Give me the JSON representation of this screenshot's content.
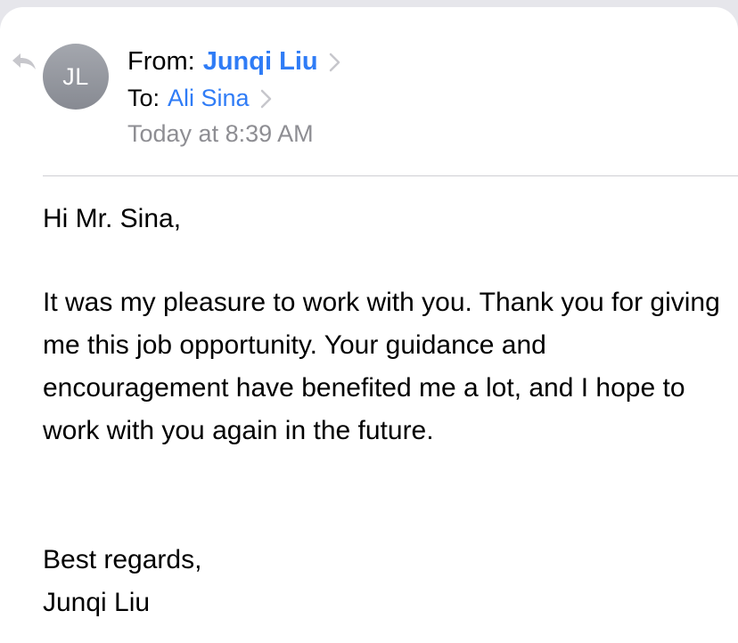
{
  "email": {
    "sender_initials": "JL",
    "from_label": "From:",
    "from_name": "Junqi Liu",
    "to_label": "To:",
    "to_name": "Ali Sina",
    "date": "Today at 8:39 AM"
  },
  "body": {
    "greeting": "Hi Mr. Sina,",
    "paragraph": "It was my pleasure to work with you. Thank you for giving me this job opportunity. Your guidance and encouragement have benefited me a lot, and I hope to work with you again in the future.",
    "closing": "Best regards,",
    "signature": "Junqi Liu"
  },
  "icons": {
    "reply": "reply-arrow-icon",
    "chevron": "chevron-right-icon"
  },
  "colors": {
    "link": "#2f7cf6",
    "secondary_text": "#8e8e93",
    "avatar": "#989ba2",
    "background": "#e6e6eb"
  }
}
